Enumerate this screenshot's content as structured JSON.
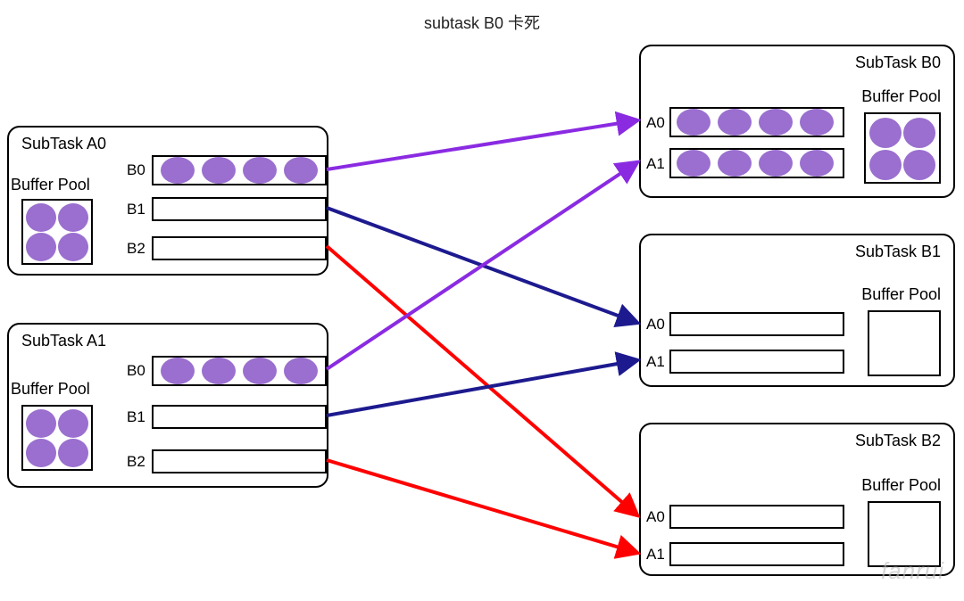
{
  "title": "subtask B0 卡死",
  "watermark": "fanrui",
  "tasks": {
    "A0": {
      "title": "SubTask A0",
      "bufferPool": "Buffer Pool",
      "queues": [
        "B0",
        "B1",
        "B2"
      ]
    },
    "A1": {
      "title": "SubTask A1",
      "bufferPool": "Buffer Pool",
      "queues": [
        "B0",
        "B1",
        "B2"
      ]
    },
    "B0": {
      "title": "SubTask B0",
      "bufferPool": "Buffer Pool",
      "queues": [
        "A0",
        "A1"
      ]
    },
    "B1": {
      "title": "SubTask B1",
      "bufferPool": "Buffer Pool",
      "queues": [
        "A0",
        "A1"
      ]
    },
    "B2": {
      "title": "SubTask B2",
      "bufferPool": "Buffer Pool",
      "queues": [
        "A0",
        "A1"
      ]
    }
  },
  "chart_data": {
    "type": "diagram",
    "description": "Flink subtask backpressure diagram: SubTask B0 is stuck (卡死). Two upstream subtasks A0 and A1 each have output queues B0/B1/B2 and a Buffer Pool. Three downstream subtasks B0/B1/B2 each have input queues A0/A1 and a Buffer Pool.",
    "upstream": [
      {
        "name": "SubTask A0",
        "buffer_pool_full": true,
        "output_queues": [
          {
            "to": "B0",
            "full": true
          },
          {
            "to": "B1",
            "full": false
          },
          {
            "to": "B2",
            "full": false
          }
        ]
      },
      {
        "name": "SubTask A1",
        "buffer_pool_full": true,
        "output_queues": [
          {
            "to": "B0",
            "full": true
          },
          {
            "to": "B1",
            "full": false
          },
          {
            "to": "B2",
            "full": false
          }
        ]
      }
    ],
    "downstream": [
      {
        "name": "SubTask B0",
        "stuck": true,
        "buffer_pool_full": true,
        "input_queues": [
          {
            "from": "A0",
            "full": true
          },
          {
            "from": "A1",
            "full": true
          }
        ]
      },
      {
        "name": "SubTask B1",
        "stuck": false,
        "buffer_pool_full": false,
        "input_queues": [
          {
            "from": "A0",
            "full": false
          },
          {
            "from": "A1",
            "full": false
          }
        ]
      },
      {
        "name": "SubTask B2",
        "stuck": false,
        "buffer_pool_full": false,
        "input_queues": [
          {
            "from": "A0",
            "full": false
          },
          {
            "from": "A1",
            "full": false
          }
        ]
      }
    ],
    "edges": [
      {
        "from": "A0.B0",
        "to": "B0.A0",
        "color": "purple"
      },
      {
        "from": "A0.B1",
        "to": "B1.A0",
        "color": "darkblue"
      },
      {
        "from": "A0.B2",
        "to": "B2.A0",
        "color": "red"
      },
      {
        "from": "A1.B0",
        "to": "B0.A1",
        "color": "purple"
      },
      {
        "from": "A1.B1",
        "to": "B1.A1",
        "color": "darkblue"
      },
      {
        "from": "A1.B2",
        "to": "B2.A1",
        "color": "red"
      }
    ],
    "colors": {
      "purple": "#8a2be2",
      "darkblue": "#1d1a8f",
      "red": "#ff0000",
      "buffer": "#9a6fcf"
    }
  }
}
